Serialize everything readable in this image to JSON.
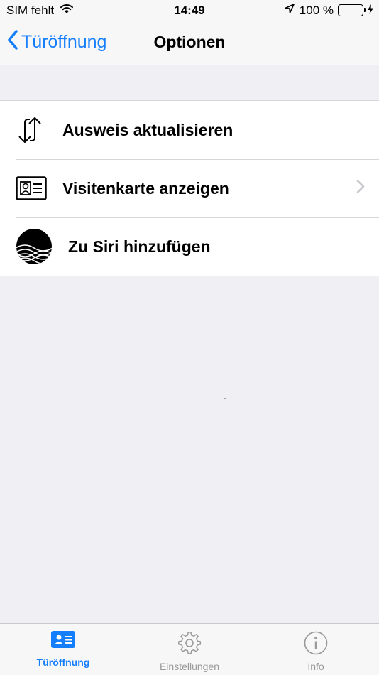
{
  "status_bar": {
    "carrier": "SIM fehlt",
    "time": "14:49",
    "battery_percent": "100 %",
    "battery_level": 1.0
  },
  "nav": {
    "back_label": "Türöffnung",
    "title": "Optionen"
  },
  "options": [
    {
      "label": "Ausweis aktualisieren",
      "icon": "refresh-arrows-icon",
      "chevron": false
    },
    {
      "label": "Visitenkarte anzeigen",
      "icon": "id-card-icon",
      "chevron": true
    },
    {
      "label": "Zu Siri hinzufügen",
      "icon": "siri-shortcut-icon",
      "chevron": false
    }
  ],
  "tabs": [
    {
      "label": "Türöffnung",
      "icon": "id-card-icon",
      "active": true
    },
    {
      "label": "Einstellungen",
      "icon": "gear-icon",
      "active": false
    },
    {
      "label": "Info",
      "icon": "info-icon",
      "active": false
    }
  ],
  "colors": {
    "accent": "#157efb",
    "battery": "#4cd964",
    "inactive_tab": "#999999",
    "background": "#efeff4"
  }
}
